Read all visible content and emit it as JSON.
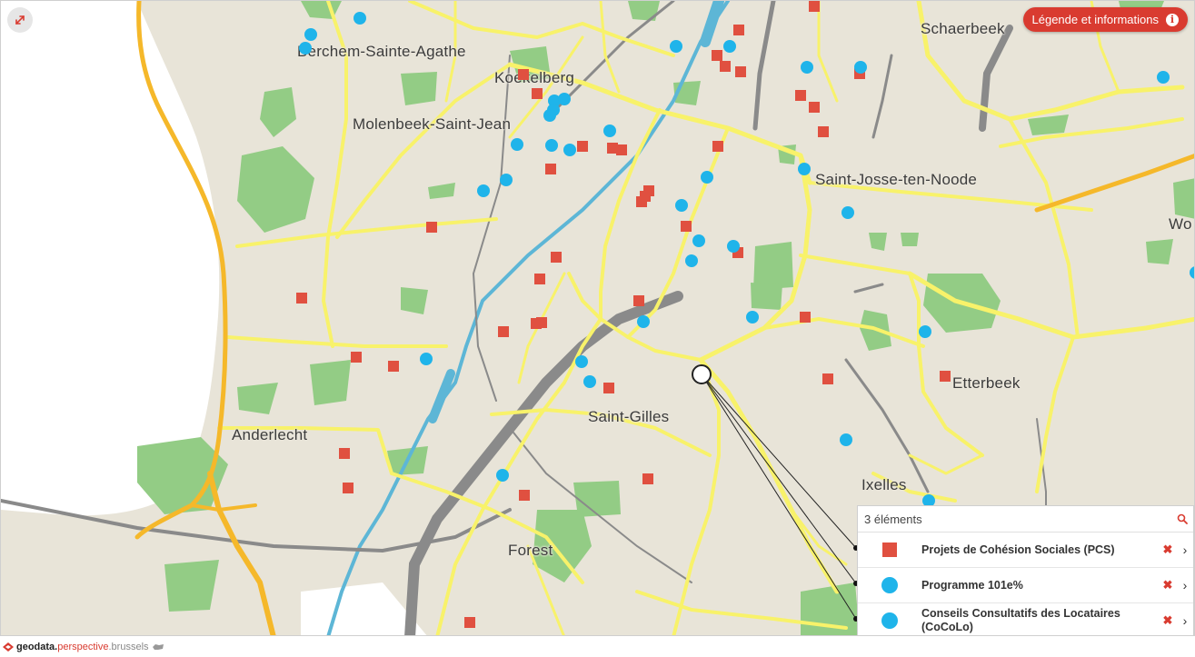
{
  "map": {
    "places": [
      {
        "id": "berchem",
        "label": "Berchem-Sainte-Agathe"
      },
      {
        "id": "koekelberg",
        "label": "Koekelberg"
      },
      {
        "id": "molenbeek",
        "label": "Molenbeek-Saint-Jean"
      },
      {
        "id": "schaerbeek",
        "label": "Schaerbeek"
      },
      {
        "id": "saint-josse",
        "label": "Saint-Josse-ten-Noode"
      },
      {
        "id": "woluwe",
        "label": "Wo"
      },
      {
        "id": "etterbeek",
        "label": "Etterbeek"
      },
      {
        "id": "anderlecht",
        "label": "Anderlecht"
      },
      {
        "id": "saint-gilles",
        "label": "Saint-Gilles"
      },
      {
        "id": "ixelles",
        "label": "Ixelles"
      },
      {
        "id": "forest",
        "label": "Forest"
      }
    ],
    "colors": {
      "land": "#e8e4d8",
      "park": "#93cc85",
      "road": "#f8f26a",
      "highway": "#f5b82a",
      "rail": "#8a8a8a",
      "water": "#5db6d6",
      "pcs": "#e05040",
      "programme": "#1fb4ea"
    },
    "expand_icon": "expand-arrows-icon",
    "legend_button": {
      "label": "Légende et informations",
      "icon": "info-icon"
    }
  },
  "panel": {
    "count_label": "3 éléments",
    "search_icon": "search-icon",
    "layers": [
      {
        "label": "Projets de Cohésion Sociales (PCS)",
        "symbol": "square",
        "color": "#e05040",
        "remove": "✖",
        "open": "›"
      },
      {
        "label": "Programme 101e%",
        "symbol": "circle",
        "color": "#1fb4ea",
        "remove": "✖",
        "open": "›"
      },
      {
        "label": "Conseils Consultatifs des Locataires (CoCoLo)",
        "symbol": "circle",
        "color": "#1fb4ea",
        "remove": "✖",
        "open": "›"
      }
    ]
  },
  "footer": {
    "brand_part1": "geodata.",
    "brand_part2": "perspective",
    "brand_part3": ".brussels",
    "logo_icon": "perspective-logo-icon"
  }
}
